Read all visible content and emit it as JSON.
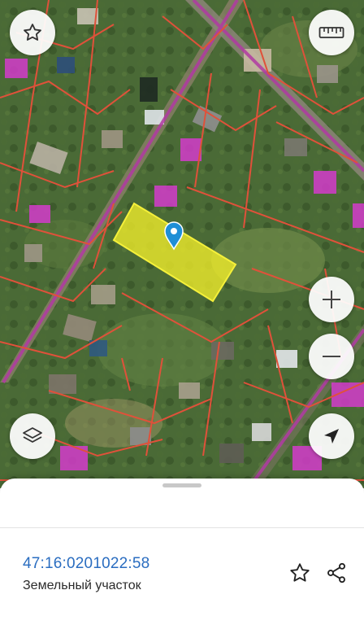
{
  "map": {
    "type": "satellite",
    "highlight_color": "#f2ee2a",
    "boundary_color": "#e0513a",
    "road_overlay_color": "#b13aa3",
    "building_mark_color": "#d33bcb",
    "pin_color": "#1f8fd6"
  },
  "controls": {
    "favorite_icon": "star-outline-icon",
    "ruler_icon": "ruler-icon",
    "zoom_in_icon": "plus-icon",
    "zoom_out_icon": "minus-icon",
    "layers_icon": "layers-icon",
    "locate_icon": "navigation-arrow-icon"
  },
  "parcel": {
    "cadastral_number": "47:16:0201022:58",
    "type": "Земельный участок"
  }
}
